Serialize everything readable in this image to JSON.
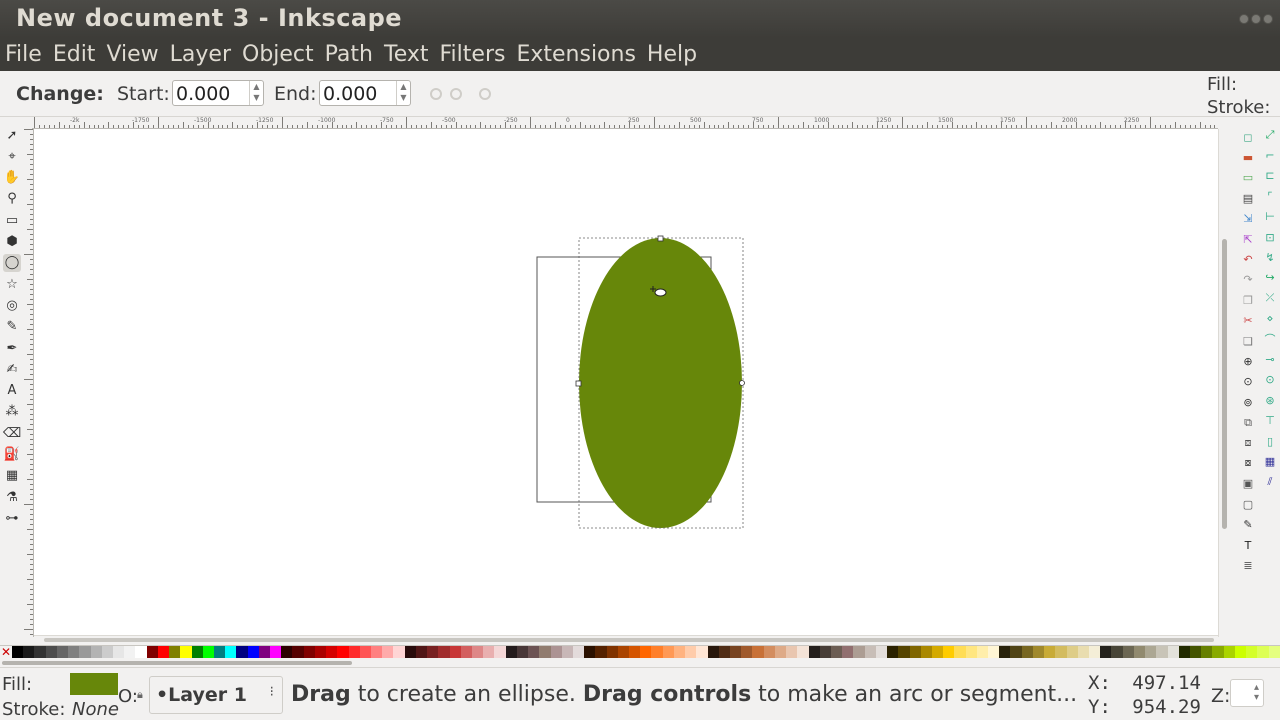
{
  "window": {
    "title": "New document 3 - Inkscape"
  },
  "menubar": {
    "items": [
      "File",
      "Edit",
      "View",
      "Layer",
      "Object",
      "Path",
      "Text",
      "Filters",
      "Extensions",
      "Help"
    ]
  },
  "tool_controls": {
    "change_label": "Change:",
    "start_label": "Start:",
    "start_value": "0.000",
    "end_label": "End:",
    "end_value": "0.000"
  },
  "style_indicator_top": {
    "fill_label": "Fill:",
    "stroke_label": "Stroke:"
  },
  "ruler": {
    "labels": [
      "-2k",
      "-1750",
      "-1500",
      "-1250",
      "-1000",
      "-750",
      "-500",
      "-250",
      "0",
      "250",
      "500",
      "750",
      "1000",
      "1250",
      "1500",
      "1750",
      "2000",
      "2250"
    ]
  },
  "toolbox": {
    "tools": [
      {
        "name": "selector",
        "glyph": "➚"
      },
      {
        "name": "node",
        "glyph": "⌖"
      },
      {
        "name": "tweak",
        "glyph": "✋"
      },
      {
        "name": "zoom",
        "glyph": "⚲"
      },
      {
        "name": "rectangle",
        "glyph": "▭"
      },
      {
        "name": "3d-box",
        "glyph": "⬢"
      },
      {
        "name": "ellipse",
        "glyph": "◯"
      },
      {
        "name": "star",
        "glyph": "☆"
      },
      {
        "name": "spiral",
        "glyph": "◎"
      },
      {
        "name": "pencil",
        "glyph": "✎"
      },
      {
        "name": "pen",
        "glyph": "✒"
      },
      {
        "name": "calligraphy",
        "glyph": "✍"
      },
      {
        "name": "text",
        "glyph": "A"
      },
      {
        "name": "spray",
        "glyph": "⁂"
      },
      {
        "name": "eraser",
        "glyph": "⌫"
      },
      {
        "name": "paint-bucket",
        "glyph": "⛽"
      },
      {
        "name": "gradient",
        "glyph": "▦"
      },
      {
        "name": "dropper",
        "glyph": "⚗"
      },
      {
        "name": "connector",
        "glyph": "⊶"
      }
    ],
    "active_tool": "ellipse"
  },
  "canvas": {
    "ellipse_fill": "#67870a",
    "selection_cue": "dashed bounding box"
  },
  "palette": {
    "none_glyph": "✕",
    "colors": [
      "#000000",
      "#1a1a1a",
      "#333333",
      "#4d4d4d",
      "#666666",
      "#808080",
      "#999999",
      "#b3b3b3",
      "#cccccc",
      "#e6e6e6",
      "#f2f2f2",
      "#ffffff",
      "#800000",
      "#ff0000",
      "#808000",
      "#ffff00",
      "#008000",
      "#00ff00",
      "#008080",
      "#00ffff",
      "#000080",
      "#0000ff",
      "#800080",
      "#ff00ff",
      "#2b0000",
      "#550000",
      "#800000",
      "#aa0000",
      "#d40000",
      "#ff0000",
      "#ff2a2a",
      "#ff5555",
      "#ff8080",
      "#ffaaaa",
      "#ffd5d5",
      "#280b0b",
      "#501616",
      "#782121",
      "#a02c2c",
      "#c83737",
      "#d35f5f",
      "#de8787",
      "#e9afaf",
      "#f4d7d7",
      "#241c1c",
      "#483737",
      "#6c5353",
      "#917c6f",
      "#ac9393",
      "#c8b7b7",
      "#e3dbdb",
      "#2b1100",
      "#552200",
      "#803300",
      "#aa4400",
      "#d45500",
      "#ff6600",
      "#ff7f2a",
      "#ff9955",
      "#ffb380",
      "#ffccaa",
      "#ffe6d5",
      "#28170b",
      "#502d16",
      "#784421",
      "#a05a2c",
      "#c87137",
      "#d38d5f",
      "#deaa87",
      "#e9c6af",
      "#f4e3d7",
      "#241f1c",
      "#483e37",
      "#6c5d53",
      "#916f6f",
      "#ac9d93",
      "#c8beb7",
      "#e3dedb",
      "#2b2200",
      "#554400",
      "#806600",
      "#aa8800",
      "#d4aa00",
      "#ffcc00",
      "#ffdd55",
      "#ffe680",
      "#ffeeaa",
      "#fff6d5",
      "#28220b",
      "#504416",
      "#786721",
      "#a0892c",
      "#c8ab37",
      "#d3bc5f",
      "#decd87",
      "#e9ddaf",
      "#f4eed7",
      "#24221c",
      "#484537",
      "#6c6753",
      "#918a6f",
      "#aca793",
      "#c8c4b7",
      "#e3e2db",
      "#222b00",
      "#445500",
      "#668000",
      "#88aa00",
      "#aad400",
      "#ccff00",
      "#d4ff2a",
      "#ddff55",
      "#e5ff80"
    ]
  },
  "statusbar": {
    "fill_label": "Fill:",
    "stroke_label": "Stroke:",
    "fill_color": "#67870a",
    "stroke_value": "None",
    "opacity_fragment": "O:",
    "layer_name": "Layer 1",
    "message": {
      "bold1": "Drag",
      "text1": " to create an ellipse. ",
      "bold2": "Drag controls",
      "text2": " to make an arc or segment..."
    },
    "x_label": "X:",
    "x_value": "497.14",
    "y_label": "Y:",
    "y_value": "954.29",
    "zoom_label": "Z:"
  }
}
